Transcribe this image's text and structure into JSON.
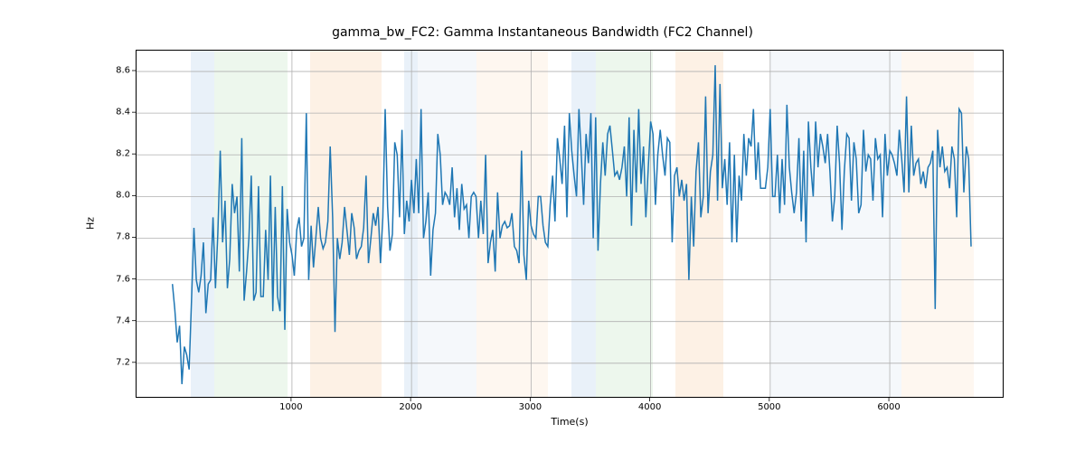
{
  "chart_data": {
    "type": "line",
    "title": "gamma_bw_FC2: Gamma Instantaneous Bandwidth (FC2 Channel)",
    "xlabel": "Time(s)",
    "ylabel": "Hz",
    "xlim": [
      -300,
      6960
    ],
    "ylim": [
      7.03,
      8.7
    ],
    "xticks": [
      1000,
      2000,
      3000,
      4000,
      5000,
      6000
    ],
    "yticks": [
      7.2,
      7.4,
      7.6,
      7.8,
      8.0,
      8.2,
      8.4,
      8.6
    ],
    "bands": [
      {
        "x0": 150,
        "x1": 350,
        "color": "#a8c8e8"
      },
      {
        "x0": 350,
        "x1": 960,
        "color": "#b8e0b8"
      },
      {
        "x0": 1150,
        "x1": 1750,
        "color": "#f7c896"
      },
      {
        "x0": 1940,
        "x1": 2050,
        "color": "#a8c8e8"
      },
      {
        "x0": 2050,
        "x1": 2540,
        "color": "#d6e4f0"
      },
      {
        "x0": 2540,
        "x1": 3140,
        "color": "#fadfc2"
      },
      {
        "x0": 3340,
        "x1": 3540,
        "color": "#a8c8e8"
      },
      {
        "x0": 3540,
        "x1": 4020,
        "color": "#b8e0b8"
      },
      {
        "x0": 4210,
        "x1": 4610,
        "color": "#f7c896"
      },
      {
        "x0": 5000,
        "x1": 6100,
        "color": "#d6e4f0"
      },
      {
        "x0": 6100,
        "x1": 6700,
        "color": "#fadfc2"
      }
    ],
    "series": [
      {
        "name": "gamma_bw_FC2",
        "color": "#1f77b4",
        "x_step": 20,
        "x_start": 0,
        "values": [
          7.58,
          7.46,
          7.3,
          7.38,
          7.1,
          7.28,
          7.24,
          7.17,
          7.5,
          7.85,
          7.6,
          7.54,
          7.62,
          7.78,
          7.44,
          7.58,
          7.6,
          7.9,
          7.56,
          7.82,
          8.22,
          7.78,
          7.98,
          7.56,
          7.7,
          8.06,
          7.92,
          8.0,
          7.64,
          8.28,
          7.5,
          7.64,
          7.8,
          8.1,
          7.5,
          7.54,
          8.05,
          7.52,
          7.52,
          7.84,
          7.6,
          8.1,
          7.45,
          7.95,
          7.52,
          7.45,
          8.05,
          7.36,
          7.94,
          7.78,
          7.72,
          7.62,
          7.84,
          7.9,
          7.76,
          7.8,
          8.4,
          7.6,
          7.86,
          7.66,
          7.8,
          7.95,
          7.8,
          7.75,
          7.78,
          7.88,
          8.24,
          7.9,
          7.35,
          7.8,
          7.7,
          7.78,
          7.95,
          7.84,
          7.72,
          7.92,
          7.85,
          7.7,
          7.74,
          7.76,
          7.85,
          8.1,
          7.68,
          7.8,
          7.92,
          7.86,
          7.95,
          7.68,
          7.9,
          8.42,
          7.95,
          7.74,
          7.82,
          8.26,
          8.2,
          7.9,
          8.32,
          7.82,
          7.98,
          7.88,
          8.08,
          7.92,
          8.18,
          7.92,
          8.42,
          7.8,
          7.88,
          8.02,
          7.62,
          7.84,
          7.92,
          8.3,
          8.2,
          7.96,
          8.02,
          8.0,
          7.96,
          8.14,
          7.9,
          8.04,
          7.84,
          8.06,
          7.94,
          7.96,
          7.8,
          8.0,
          8.02,
          8.0,
          7.8,
          7.98,
          7.82,
          8.2,
          7.68,
          7.78,
          7.84,
          7.64,
          8.02,
          7.8,
          7.86,
          7.88,
          7.85,
          7.86,
          7.92,
          7.76,
          7.74,
          7.68,
          8.22,
          7.72,
          7.6,
          7.98,
          7.86,
          7.82,
          7.8,
          8.0,
          8.0,
          7.86,
          7.78,
          7.76,
          7.96,
          8.1,
          7.88,
          8.28,
          8.18,
          8.06,
          8.34,
          7.9,
          8.4,
          8.22,
          8.1,
          8.0,
          8.42,
          8.2,
          7.96,
          8.3,
          8.16,
          8.4,
          7.8,
          8.38,
          7.74,
          8.06,
          8.26,
          8.1,
          8.3,
          8.34,
          8.22,
          8.1,
          8.12,
          8.08,
          8.14,
          8.24,
          8.0,
          8.38,
          7.86,
          8.32,
          8.02,
          8.42,
          8.06,
          8.24,
          7.9,
          8.14,
          8.36,
          8.3,
          7.96,
          8.2,
          8.32,
          8.2,
          8.1,
          8.28,
          8.26,
          7.78,
          8.1,
          8.14,
          8.0,
          8.08,
          7.98,
          8.06,
          7.6,
          8.0,
          7.76,
          8.12,
          8.26,
          7.9,
          8.0,
          8.48,
          7.92,
          8.12,
          8.2,
          8.63,
          7.98,
          8.54,
          8.04,
          8.18,
          7.96,
          8.26,
          7.78,
          8.2,
          7.78,
          8.1,
          7.98,
          8.3,
          8.1,
          8.28,
          8.24,
          8.42,
          8.08,
          8.26,
          8.04,
          8.04,
          8.04,
          8.14,
          8.42,
          8.0,
          8.0,
          8.2,
          7.92,
          8.18,
          7.96,
          8.44,
          8.14,
          8.02,
          7.92,
          8.02,
          8.28,
          7.88,
          8.22,
          7.78,
          8.36,
          8.14,
          8.0,
          8.36,
          8.14,
          8.3,
          8.24,
          8.16,
          8.3,
          8.12,
          7.88,
          8.0,
          8.34,
          8.16,
          7.84,
          8.12,
          8.3,
          8.28,
          7.98,
          8.26,
          8.18,
          7.92,
          7.96,
          8.32,
          8.12,
          8.2,
          8.18,
          7.98,
          8.28,
          8.18,
          8.2,
          7.9,
          8.3,
          8.1,
          8.22,
          8.2,
          8.16,
          8.1,
          8.32,
          8.18,
          8.02,
          8.48,
          8.02,
          8.34,
          8.1,
          8.16,
          8.18,
          8.06,
          8.12,
          8.04,
          8.14,
          8.16,
          8.22,
          7.46,
          8.32,
          8.14,
          8.24,
          8.12,
          8.14,
          8.04,
          8.24,
          8.18,
          7.9,
          8.42,
          8.4,
          8.02,
          8.24,
          8.18,
          7.76
        ]
      }
    ]
  }
}
